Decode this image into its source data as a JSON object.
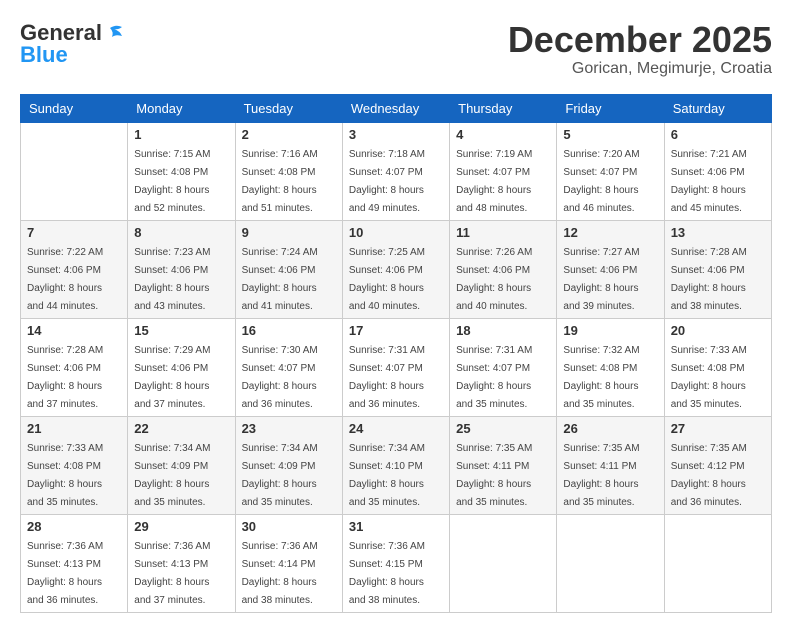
{
  "header": {
    "logo_line1": "General",
    "logo_line2": "Blue",
    "month_title": "December 2025",
    "location": "Gorican, Megimurje, Croatia"
  },
  "days_of_week": [
    "Sunday",
    "Monday",
    "Tuesday",
    "Wednesday",
    "Thursday",
    "Friday",
    "Saturday"
  ],
  "weeks": [
    [
      {
        "day": "",
        "sunrise": "",
        "sunset": "",
        "daylight": ""
      },
      {
        "day": "1",
        "sunrise": "Sunrise: 7:15 AM",
        "sunset": "Sunset: 4:08 PM",
        "daylight": "Daylight: 8 hours and 52 minutes."
      },
      {
        "day": "2",
        "sunrise": "Sunrise: 7:16 AM",
        "sunset": "Sunset: 4:08 PM",
        "daylight": "Daylight: 8 hours and 51 minutes."
      },
      {
        "day": "3",
        "sunrise": "Sunrise: 7:18 AM",
        "sunset": "Sunset: 4:07 PM",
        "daylight": "Daylight: 8 hours and 49 minutes."
      },
      {
        "day": "4",
        "sunrise": "Sunrise: 7:19 AM",
        "sunset": "Sunset: 4:07 PM",
        "daylight": "Daylight: 8 hours and 48 minutes."
      },
      {
        "day": "5",
        "sunrise": "Sunrise: 7:20 AM",
        "sunset": "Sunset: 4:07 PM",
        "daylight": "Daylight: 8 hours and 46 minutes."
      },
      {
        "day": "6",
        "sunrise": "Sunrise: 7:21 AM",
        "sunset": "Sunset: 4:06 PM",
        "daylight": "Daylight: 8 hours and 45 minutes."
      }
    ],
    [
      {
        "day": "7",
        "sunrise": "Sunrise: 7:22 AM",
        "sunset": "Sunset: 4:06 PM",
        "daylight": "Daylight: 8 hours and 44 minutes."
      },
      {
        "day": "8",
        "sunrise": "Sunrise: 7:23 AM",
        "sunset": "Sunset: 4:06 PM",
        "daylight": "Daylight: 8 hours and 43 minutes."
      },
      {
        "day": "9",
        "sunrise": "Sunrise: 7:24 AM",
        "sunset": "Sunset: 4:06 PM",
        "daylight": "Daylight: 8 hours and 41 minutes."
      },
      {
        "day": "10",
        "sunrise": "Sunrise: 7:25 AM",
        "sunset": "Sunset: 4:06 PM",
        "daylight": "Daylight: 8 hours and 40 minutes."
      },
      {
        "day": "11",
        "sunrise": "Sunrise: 7:26 AM",
        "sunset": "Sunset: 4:06 PM",
        "daylight": "Daylight: 8 hours and 40 minutes."
      },
      {
        "day": "12",
        "sunrise": "Sunrise: 7:27 AM",
        "sunset": "Sunset: 4:06 PM",
        "daylight": "Daylight: 8 hours and 39 minutes."
      },
      {
        "day": "13",
        "sunrise": "Sunrise: 7:28 AM",
        "sunset": "Sunset: 4:06 PM",
        "daylight": "Daylight: 8 hours and 38 minutes."
      }
    ],
    [
      {
        "day": "14",
        "sunrise": "Sunrise: 7:28 AM",
        "sunset": "Sunset: 4:06 PM",
        "daylight": "Daylight: 8 hours and 37 minutes."
      },
      {
        "day": "15",
        "sunrise": "Sunrise: 7:29 AM",
        "sunset": "Sunset: 4:06 PM",
        "daylight": "Daylight: 8 hours and 37 minutes."
      },
      {
        "day": "16",
        "sunrise": "Sunrise: 7:30 AM",
        "sunset": "Sunset: 4:07 PM",
        "daylight": "Daylight: 8 hours and 36 minutes."
      },
      {
        "day": "17",
        "sunrise": "Sunrise: 7:31 AM",
        "sunset": "Sunset: 4:07 PM",
        "daylight": "Daylight: 8 hours and 36 minutes."
      },
      {
        "day": "18",
        "sunrise": "Sunrise: 7:31 AM",
        "sunset": "Sunset: 4:07 PM",
        "daylight": "Daylight: 8 hours and 35 minutes."
      },
      {
        "day": "19",
        "sunrise": "Sunrise: 7:32 AM",
        "sunset": "Sunset: 4:08 PM",
        "daylight": "Daylight: 8 hours and 35 minutes."
      },
      {
        "day": "20",
        "sunrise": "Sunrise: 7:33 AM",
        "sunset": "Sunset: 4:08 PM",
        "daylight": "Daylight: 8 hours and 35 minutes."
      }
    ],
    [
      {
        "day": "21",
        "sunrise": "Sunrise: 7:33 AM",
        "sunset": "Sunset: 4:08 PM",
        "daylight": "Daylight: 8 hours and 35 minutes."
      },
      {
        "day": "22",
        "sunrise": "Sunrise: 7:34 AM",
        "sunset": "Sunset: 4:09 PM",
        "daylight": "Daylight: 8 hours and 35 minutes."
      },
      {
        "day": "23",
        "sunrise": "Sunrise: 7:34 AM",
        "sunset": "Sunset: 4:09 PM",
        "daylight": "Daylight: 8 hours and 35 minutes."
      },
      {
        "day": "24",
        "sunrise": "Sunrise: 7:34 AM",
        "sunset": "Sunset: 4:10 PM",
        "daylight": "Daylight: 8 hours and 35 minutes."
      },
      {
        "day": "25",
        "sunrise": "Sunrise: 7:35 AM",
        "sunset": "Sunset: 4:11 PM",
        "daylight": "Daylight: 8 hours and 35 minutes."
      },
      {
        "day": "26",
        "sunrise": "Sunrise: 7:35 AM",
        "sunset": "Sunset: 4:11 PM",
        "daylight": "Daylight: 8 hours and 35 minutes."
      },
      {
        "day": "27",
        "sunrise": "Sunrise: 7:35 AM",
        "sunset": "Sunset: 4:12 PM",
        "daylight": "Daylight: 8 hours and 36 minutes."
      }
    ],
    [
      {
        "day": "28",
        "sunrise": "Sunrise: 7:36 AM",
        "sunset": "Sunset: 4:13 PM",
        "daylight": "Daylight: 8 hours and 36 minutes."
      },
      {
        "day": "29",
        "sunrise": "Sunrise: 7:36 AM",
        "sunset": "Sunset: 4:13 PM",
        "daylight": "Daylight: 8 hours and 37 minutes."
      },
      {
        "day": "30",
        "sunrise": "Sunrise: 7:36 AM",
        "sunset": "Sunset: 4:14 PM",
        "daylight": "Daylight: 8 hours and 38 minutes."
      },
      {
        "day": "31",
        "sunrise": "Sunrise: 7:36 AM",
        "sunset": "Sunset: 4:15 PM",
        "daylight": "Daylight: 8 hours and 38 minutes."
      },
      {
        "day": "",
        "sunrise": "",
        "sunset": "",
        "daylight": ""
      },
      {
        "day": "",
        "sunrise": "",
        "sunset": "",
        "daylight": ""
      },
      {
        "day": "",
        "sunrise": "",
        "sunset": "",
        "daylight": ""
      }
    ]
  ]
}
